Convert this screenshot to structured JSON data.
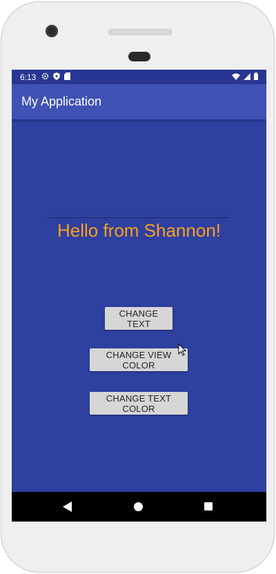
{
  "status": {
    "time": "6:13"
  },
  "app": {
    "title": "My Application"
  },
  "content": {
    "hello_text": "Hello from Shannon!"
  },
  "buttons": {
    "change_text": "CHANGE TEXT",
    "change_view_color": "CHANGE VIEW COLOR",
    "change_text_color": "CHANGE TEXT COLOR"
  },
  "icons": {
    "status_left": [
      "gear-icon",
      "shield-icon",
      "sd-card-icon"
    ],
    "status_right": [
      "wifi-icon",
      "cell-signal-icon",
      "battery-icon"
    ],
    "nav": [
      "back-icon",
      "home-icon",
      "recents-icon"
    ]
  },
  "colors": {
    "status_bar": "#283593",
    "app_bar": "#3f51b5",
    "background": "#2e40a0",
    "hello_text": "#ff9f1c",
    "button": "#d6d6d6",
    "nav_bar": "#000000"
  }
}
